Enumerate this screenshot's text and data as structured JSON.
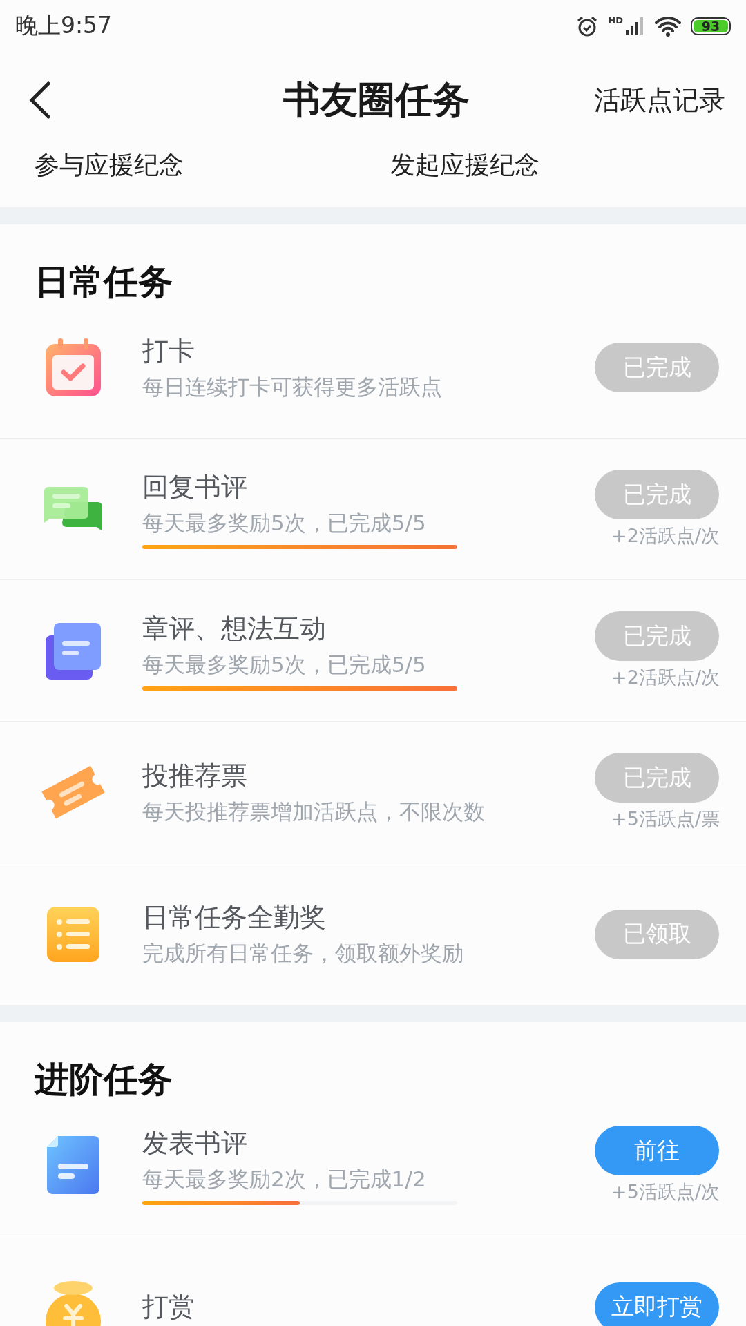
{
  "status_bar": {
    "time": "晚上9:57",
    "network_label": "HD",
    "battery": "93"
  },
  "header": {
    "title": "书友圈任务",
    "action": "活跃点记录"
  },
  "tabs": [
    {
      "label": "参与应援纪念"
    },
    {
      "label": "发起应援纪念"
    }
  ],
  "sections": [
    {
      "title": "日常任务",
      "tasks": [
        {
          "title": "打卡",
          "subtitle": "每日连续打卡可获得更多活跃点",
          "button": "已完成",
          "done": true
        },
        {
          "title": "回复书评",
          "subtitle": "每天最多奖励5次，已完成5/5",
          "level": 1,
          "button": "已完成",
          "done": true,
          "reward": "+2活跃点/次"
        },
        {
          "title": "章评、想法互动",
          "subtitle": "每天最多奖励5次，已完成5/5",
          "level": 1,
          "button": "已完成",
          "done": true,
          "reward": "+2活跃点/次"
        },
        {
          "title": "投推荐票",
          "subtitle": "每天投推荐票增加活跃点，不限次数",
          "button": "已完成",
          "done": true,
          "reward": "+5活跃点/票"
        },
        {
          "title": "日常任务全勤奖",
          "subtitle": "完成所有日常任务，领取额外奖励",
          "button": "已领取",
          "done": true
        }
      ]
    },
    {
      "title": "进阶任务",
      "tasks": [
        {
          "title": "发表书评",
          "subtitle": "每天最多奖励2次，已完成1/2",
          "level": 0.5,
          "button": "前往",
          "done": false,
          "reward": "+5活跃点/次"
        },
        {
          "title": "打赏",
          "button": "立即打赏",
          "done": false
        }
      ]
    }
  ]
}
